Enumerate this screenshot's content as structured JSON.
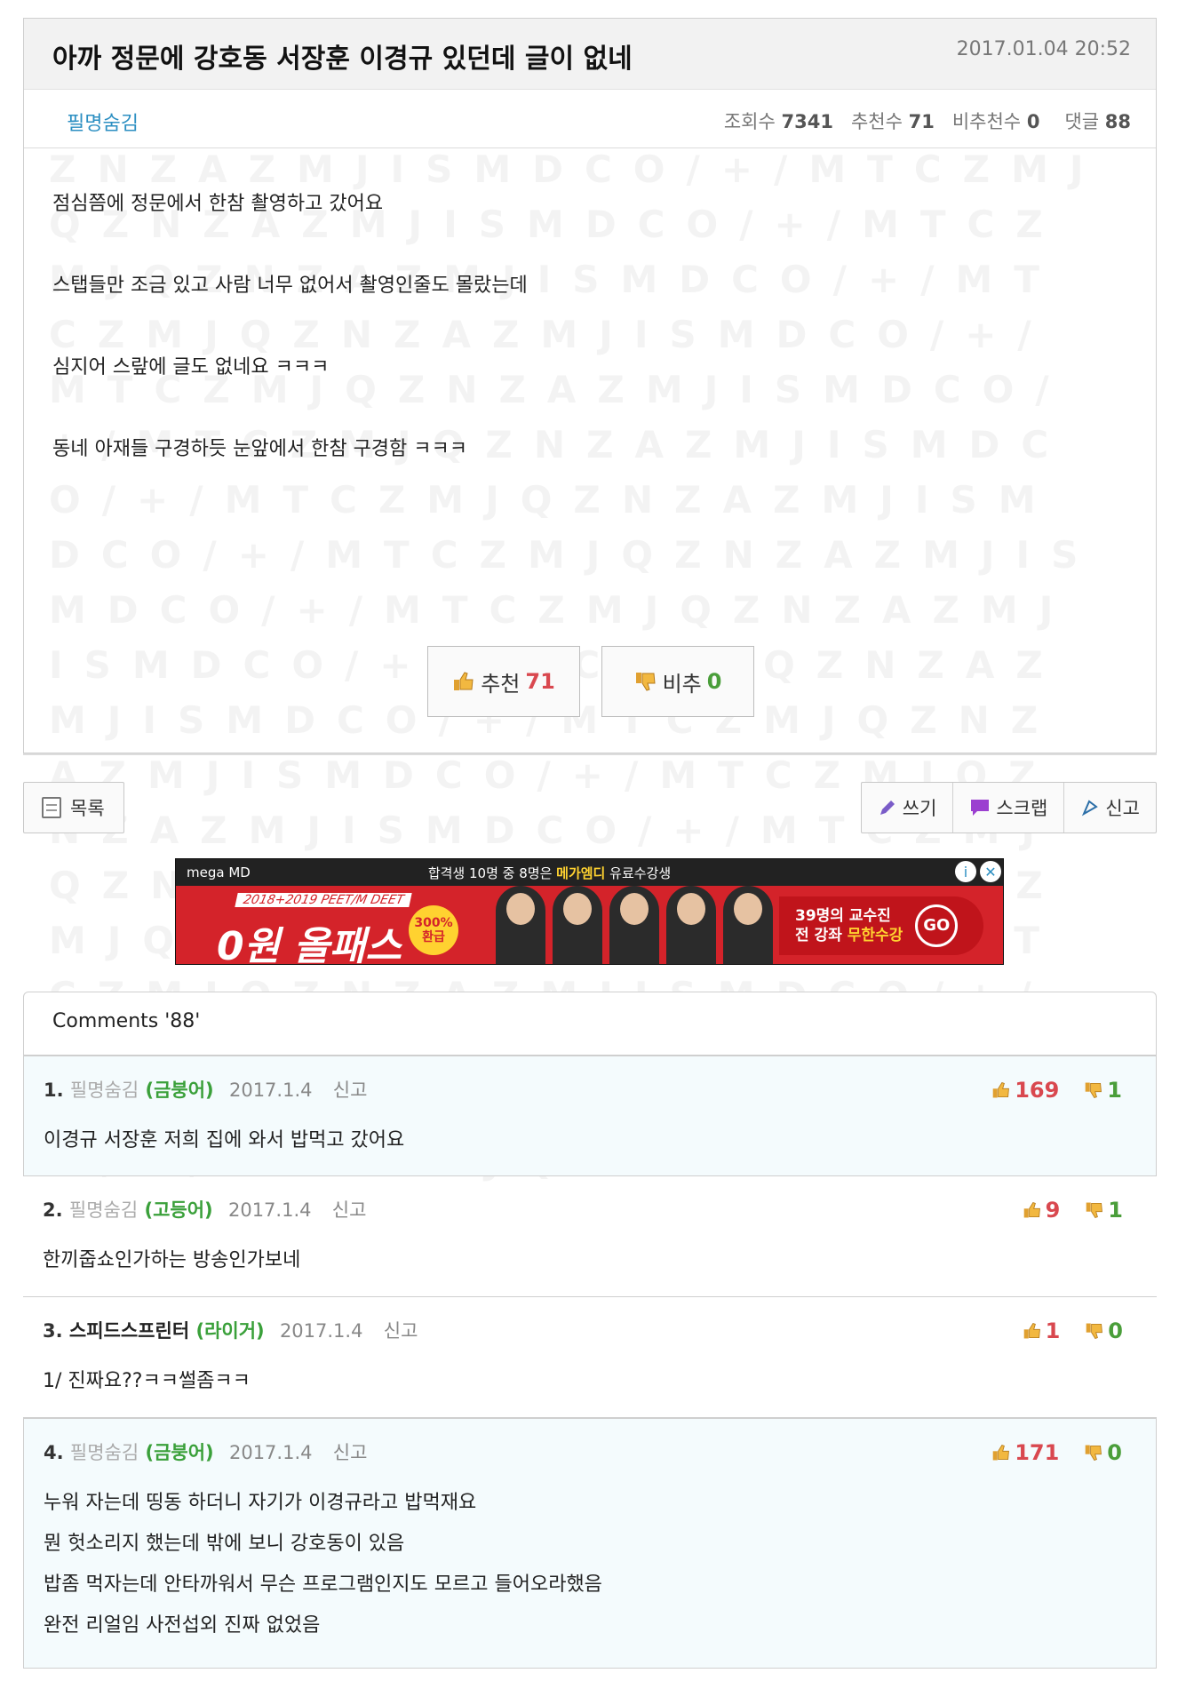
{
  "post": {
    "title": "아까 정문에 강호동 서장훈 이경규 있던데 글이 없네",
    "date": "2017.01.04 20:52",
    "author": "필명숨김",
    "views_label": "조회수",
    "views": "7341",
    "recommend_label": "추천수",
    "recommend": "71",
    "notrecommend_label": "비추천수",
    "notrecommend": "0",
    "comments_label": "댓글",
    "comments": "88",
    "body": [
      "점심쯤에 정문에서 한참 촬영하고 갔어요",
      "스탭들만 조금 있고 사람 너무 없어서 촬영인줄도 몰랐는데",
      "심지어 스랖에 글도 없네요 ㅋㅋㅋ",
      "동네 아재들 구경하듯 눈앞에서 한참 구경함 ㅋㅋㅋ"
    ],
    "vote_up_label": "추천",
    "vote_up": "71",
    "vote_down_label": "비추",
    "vote_down": "0"
  },
  "toolbar": {
    "list_label": "목록",
    "write_label": "쓰기",
    "scrap_label": "스크랩",
    "report_label": "신고"
  },
  "ad": {
    "brand": "mega MD",
    "headline_a": "합격생 10명 중 8명은",
    "headline_b": "메가엠디",
    "headline_c": "유료수강생",
    "sub": "2018+2019 PEET/M DEET",
    "big": "0원 올패스",
    "badge": "300% 환급",
    "cta_a": "39명의 교수진",
    "cta_b": "전 강좌",
    "cta_c": "무한수강",
    "go": "GO",
    "colors": {
      "red": "#d4232a",
      "yellow": "#ffd230"
    }
  },
  "comments_header": "Comments '88'",
  "comments": [
    {
      "num": "1.",
      "author": "필명숨김",
      "level": "(금붕어)",
      "date": "2017.1.4",
      "report": "신고",
      "up": "169",
      "down": "1",
      "lines": [
        "이경규 서장훈 저희 집에 와서 밥먹고 갔어요"
      ]
    },
    {
      "num": "2.",
      "author": "필명숨김",
      "level": "(고등어)",
      "date": "2017.1.4",
      "report": "신고",
      "up": "9",
      "down": "1",
      "lines": [
        "한끼줍쇼인가하는 방송인가보네"
      ]
    },
    {
      "num": "3.",
      "author": "스피드스프린터",
      "level": "(라이거)",
      "date": "2017.1.4",
      "report": "신고",
      "up": "1",
      "down": "0",
      "lines": [
        "1/ 진짜요??ㅋㅋ썰좀ㅋㅋ"
      ]
    },
    {
      "num": "4.",
      "author": "필명숨김",
      "level": "(금붕어)",
      "date": "2017.1.4",
      "report": "신고",
      "up": "171",
      "down": "0",
      "lines": [
        "누워 자는데 띵동 하더니 자기가 이경규라고 밥먹재요",
        "뭔 헛소리지 했는데 밖에 보니 강호동이 있음",
        "밥좀 먹자는데 안타까워서 무슨 프로그램인지도 모르고 들어오라했음",
        "완전 리얼임 사전섭외 진짜 없었음"
      ]
    }
  ]
}
